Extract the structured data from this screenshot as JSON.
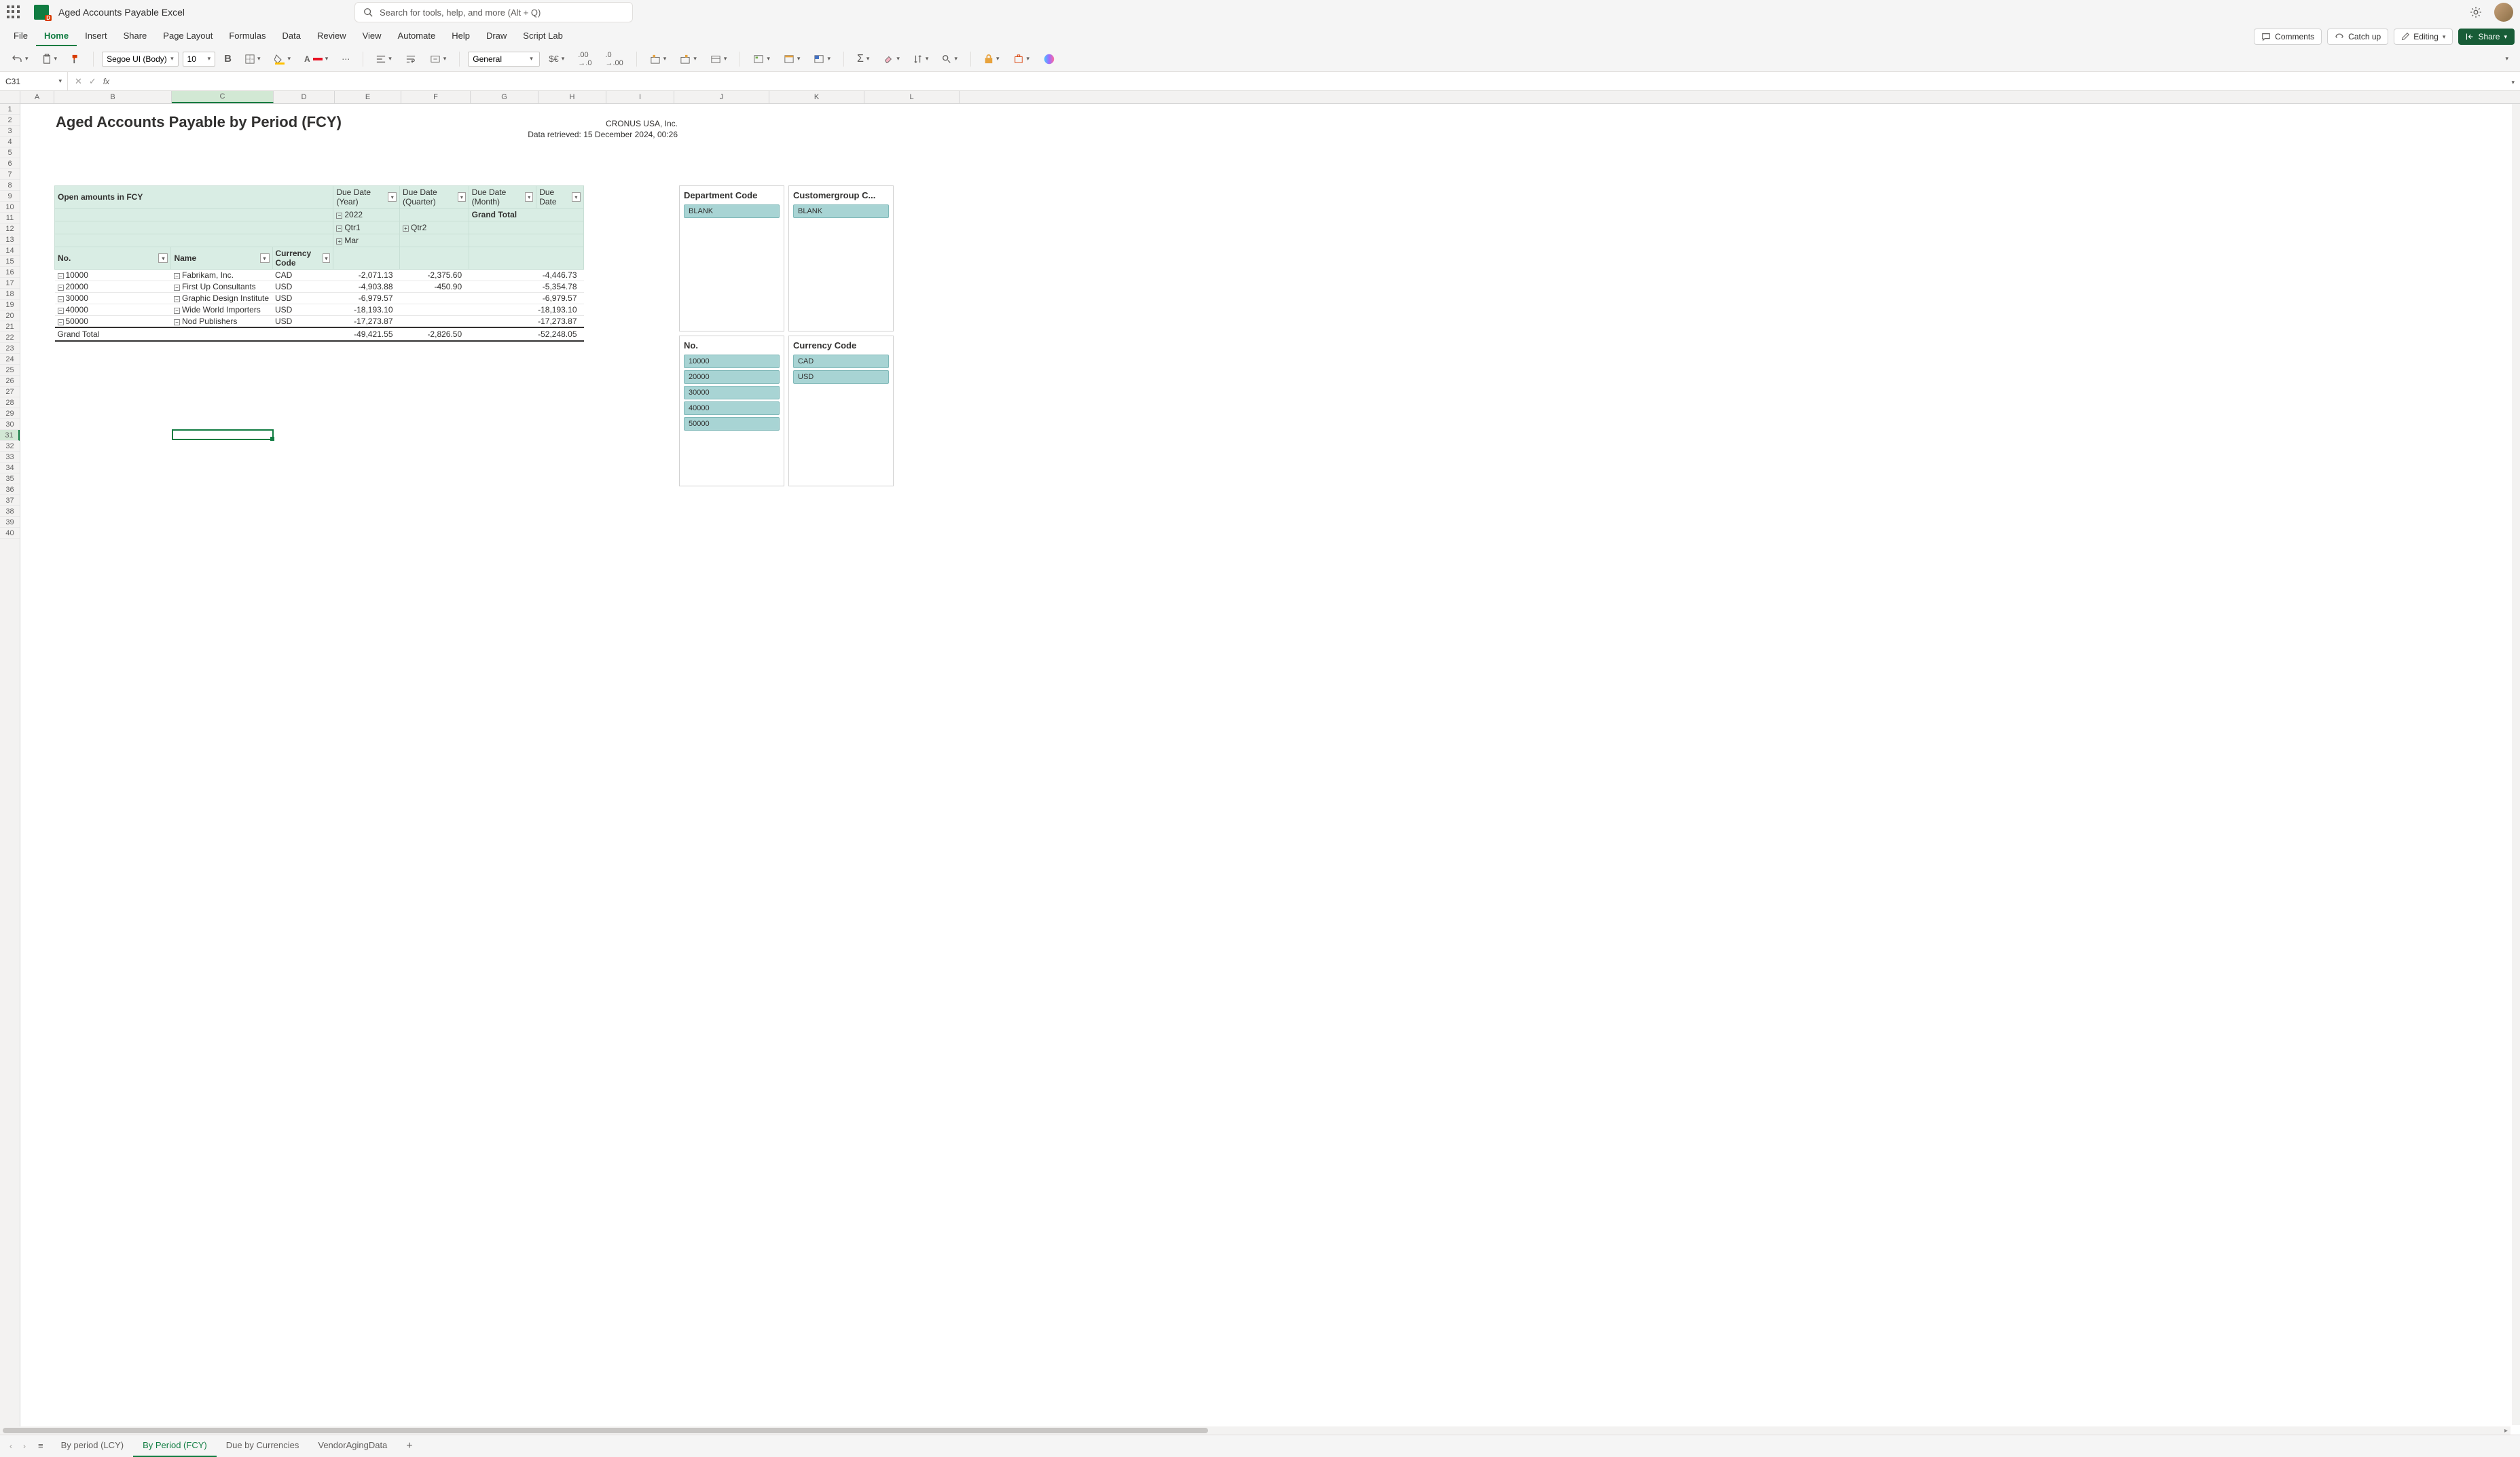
{
  "titlebar": {
    "doc_title": "Aged Accounts Payable Excel",
    "search_placeholder": "Search for tools, help, and more (Alt + Q)"
  },
  "menubar": {
    "tabs": [
      "File",
      "Home",
      "Insert",
      "Share",
      "Page Layout",
      "Formulas",
      "Data",
      "Review",
      "View",
      "Automate",
      "Help",
      "Draw",
      "Script Lab"
    ],
    "active_tab": "Home",
    "comments": "Comments",
    "catchup": "Catch up",
    "editing": "Editing",
    "share": "Share"
  },
  "ribbon": {
    "font_name": "Segoe UI (Body)",
    "font_size": "10",
    "number_format": "General"
  },
  "formulabar": {
    "namebox": "C31",
    "fx": "fx"
  },
  "columns": [
    {
      "l": "A",
      "w": 50
    },
    {
      "l": "B",
      "w": 173
    },
    {
      "l": "C",
      "w": 150
    },
    {
      "l": "D",
      "w": 90
    },
    {
      "l": "E",
      "w": 98
    },
    {
      "l": "F",
      "w": 102
    },
    {
      "l": "G",
      "w": 100
    },
    {
      "l": "H",
      "w": 100
    },
    {
      "l": "I",
      "w": 100
    },
    {
      "l": "J",
      "w": 140
    },
    {
      "l": "K",
      "w": 140
    },
    {
      "l": "L",
      "w": 140
    }
  ],
  "row_count": 40,
  "selected_row": 31,
  "selected_col_idx": 2,
  "report": {
    "title": "Aged Accounts Payable by Period (FCY)",
    "company": "CRONUS USA, Inc.",
    "retrieved": "Data retrieved: 15 December 2024, 00:26",
    "pivot_header": "Open amounts in FCY",
    "col_fields": [
      "Due Date (Year)",
      "Due Date (Quarter)",
      "Due Date (Month)",
      "Due Date"
    ],
    "year": "2022",
    "qtr1": "Qtr1",
    "qtr2": "Qtr2",
    "mar": "Mar",
    "grand_total_label": "Grand Total",
    "row_fields": [
      "No.",
      "Name",
      "Currency Code"
    ],
    "rows": [
      {
        "no": "10000",
        "name": "Fabrikam, Inc.",
        "cur": "CAD",
        "c1": "-2,071.13",
        "c2": "-2,375.60",
        "gt": "-4,446.73"
      },
      {
        "no": "20000",
        "name": "First Up Consultants",
        "cur": "USD",
        "c1": "-4,903.88",
        "c2": "-450.90",
        "gt": "-5,354.78"
      },
      {
        "no": "30000",
        "name": "Graphic Design Institute",
        "cur": "USD",
        "c1": "-6,979.57",
        "c2": "",
        "gt": "-6,979.57"
      },
      {
        "no": "40000",
        "name": "Wide World Importers",
        "cur": "USD",
        "c1": "-18,193.10",
        "c2": "",
        "gt": "-18,193.10"
      },
      {
        "no": "50000",
        "name": "Nod Publishers",
        "cur": "USD",
        "c1": "-17,273.87",
        "c2": "",
        "gt": "-17,273.87"
      }
    ],
    "totals": {
      "c1": "-49,421.55",
      "c2": "-2,826.50",
      "gt": "-52,248.05"
    }
  },
  "slicers": [
    {
      "title": "Department Code",
      "items": [
        "BLANK"
      ]
    },
    {
      "title": "Customergroup C...",
      "items": [
        "BLANK"
      ]
    },
    {
      "title": "No.",
      "items": [
        "10000",
        "20000",
        "30000",
        "40000",
        "50000"
      ]
    },
    {
      "title": "Currency Code",
      "items": [
        "CAD",
        "USD"
      ]
    }
  ],
  "sheettabs": {
    "tabs": [
      "By period (LCY)",
      "By Period (FCY)",
      "Due by Currencies",
      "VendorAgingData"
    ],
    "active": 1
  },
  "scroll": {
    "thumb_width_pct": 48
  },
  "chart_data": {
    "type": "table",
    "title": "Aged Accounts Payable by Period (FCY) — Open amounts in FCY",
    "row_dimensions": [
      "No.",
      "Name",
      "Currency Code"
    ],
    "column_dimensions": [
      "Due Date (Year)",
      "Due Date (Quarter)",
      "Due Date (Month)",
      "Due Date"
    ],
    "columns": [
      "2022 / Qtr1 / Mar",
      "2022 / Qtr2",
      "Grand Total"
    ],
    "rows": [
      {
        "No.": "10000",
        "Name": "Fabrikam, Inc.",
        "Currency Code": "CAD",
        "values": [
          -2071.13,
          -2375.6,
          -4446.73
        ]
      },
      {
        "No.": "20000",
        "Name": "First Up Consultants",
        "Currency Code": "USD",
        "values": [
          -4903.88,
          -450.9,
          -5354.78
        ]
      },
      {
        "No.": "30000",
        "Name": "Graphic Design Institute",
        "Currency Code": "USD",
        "values": [
          -6979.57,
          null,
          -6979.57
        ]
      },
      {
        "No.": "40000",
        "Name": "Wide World Importers",
        "Currency Code": "USD",
        "values": [
          -18193.1,
          null,
          -18193.1
        ]
      },
      {
        "No.": "50000",
        "Name": "Nod Publishers",
        "Currency Code": "USD",
        "values": [
          -17273.87,
          null,
          -17273.87
        ]
      }
    ],
    "grand_total": [
      -49421.55,
      -2826.5,
      -52248.05
    ]
  }
}
